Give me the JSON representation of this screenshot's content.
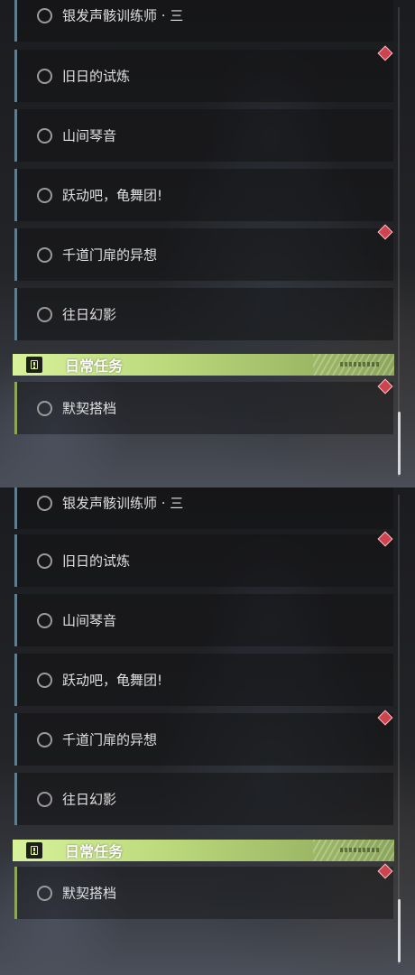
{
  "quests": [
    {
      "label": "银发声骸训练师 · 三"
    },
    {
      "label": "旧日的试炼"
    },
    {
      "label": "山间琴音"
    },
    {
      "label": "跃动吧，龟舞团!"
    },
    {
      "label": "千道门扉的异想"
    },
    {
      "label": "往日幻影"
    }
  ],
  "daily_section": {
    "title": "日常任务",
    "items": [
      {
        "label": "默契搭档"
      }
    ]
  },
  "colors": {
    "quest_accent": "#5f7d8c",
    "daily_accent": "#8fa65a",
    "section_bg": "#c8e68a",
    "marker": "#d0434e"
  },
  "icons": {
    "quest_status": "circle-icon",
    "section": "exclamation-icon",
    "marker": "diamond-icon"
  }
}
